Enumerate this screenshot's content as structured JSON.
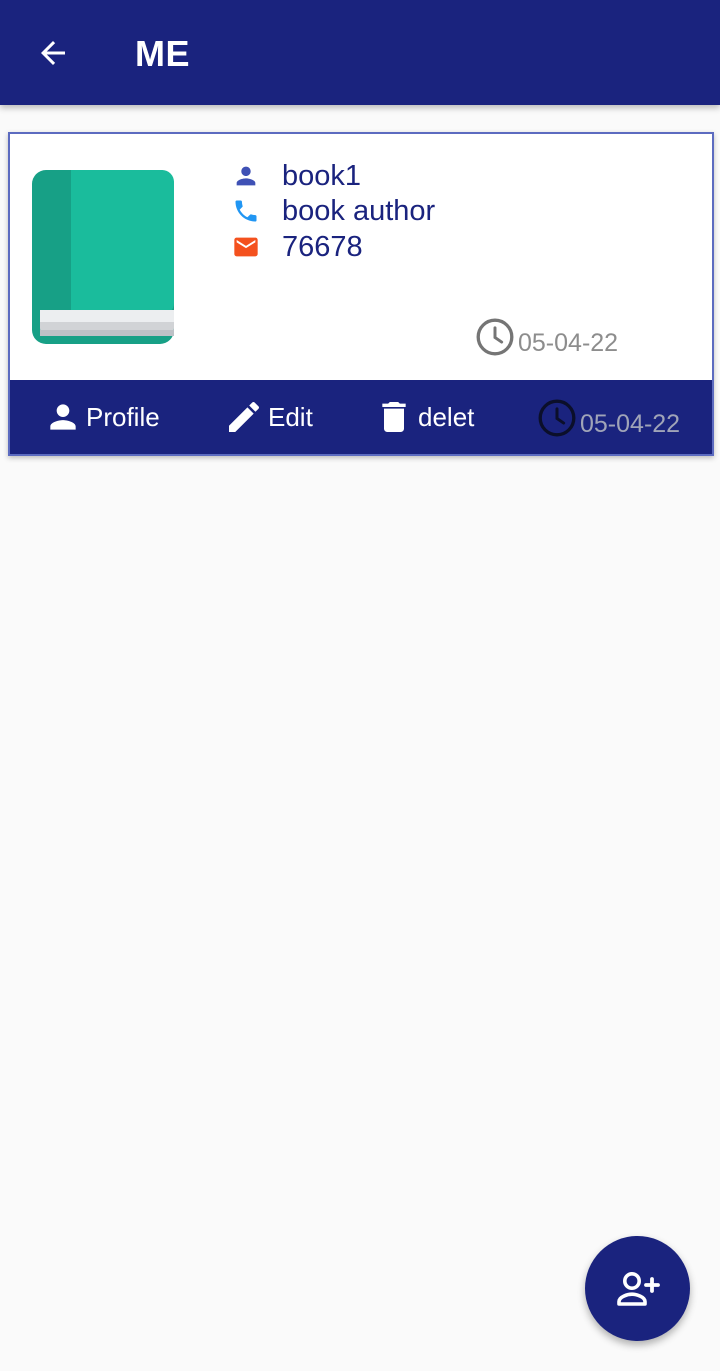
{
  "appbar": {
    "title": "ME",
    "back_icon": "arrow-back-icon"
  },
  "card": {
    "image_icon": "book-icon",
    "name": "book1",
    "author": "book author",
    "number": "76678",
    "date": "05-04-22",
    "icons": {
      "name": "person-icon",
      "author": "phone-icon",
      "number": "email-icon",
      "date": "clock-icon"
    },
    "colors": {
      "name_icon": "#3f51b5",
      "author_icon": "#2196f3",
      "number_icon": "#f4511e",
      "text": "#1a237e",
      "border": "#5c6bc0"
    }
  },
  "actions": {
    "profile_label": "Profile",
    "edit_label": "Edit",
    "delete_label": "delet",
    "date": "05-04-22"
  },
  "fab": {
    "icon": "person-add-icon"
  },
  "theme": {
    "primary": "#1a237e",
    "background": "#fafafa"
  }
}
